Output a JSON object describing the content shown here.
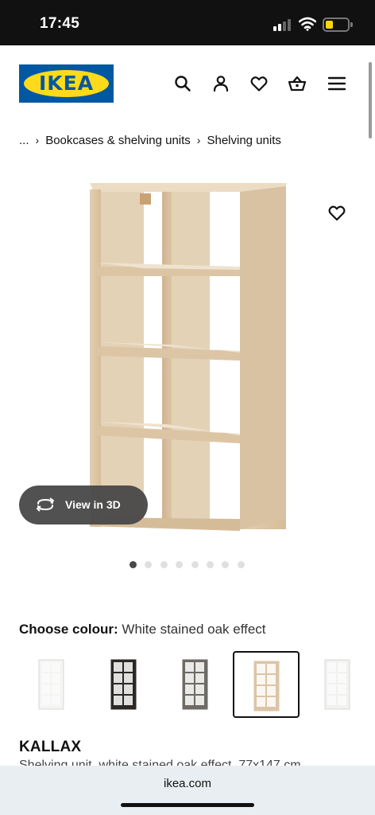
{
  "status_bar": {
    "time": "17:45"
  },
  "header": {
    "logo_text": "IKEA",
    "icons": [
      "search-icon",
      "account-icon",
      "favourites-icon",
      "shopping-bag-icon",
      "menu-icon"
    ]
  },
  "breadcrumb": {
    "ellipsis": "...",
    "separator": "›",
    "items": [
      "Bookcases & shelving units",
      "Shelving units"
    ]
  },
  "gallery": {
    "view3d_label": "View in 3D",
    "slide_count": 8,
    "active_slide": 1
  },
  "colour": {
    "label": "Choose colour:",
    "value": "White stained oak effect",
    "selected_index": 3,
    "swatches": [
      {
        "name": "white",
        "color": "#f4f4f2"
      },
      {
        "name": "black-brown",
        "color": "#2b2826"
      },
      {
        "name": "grey-effect",
        "color": "#6e6a66"
      },
      {
        "name": "white-stained-oak",
        "color": "#dcc5a5"
      },
      {
        "name": "white-2",
        "color": "#f1f1ef"
      }
    ]
  },
  "product": {
    "name": "KALLAX",
    "description": "Shelving unit, white stained oak effect, 77x147 cm"
  },
  "browser": {
    "url": "ikea.com"
  },
  "colors": {
    "ikea_blue": "#0058a3",
    "ikea_yellow": "#ffda1a",
    "wood": "#dcc5a5"
  }
}
